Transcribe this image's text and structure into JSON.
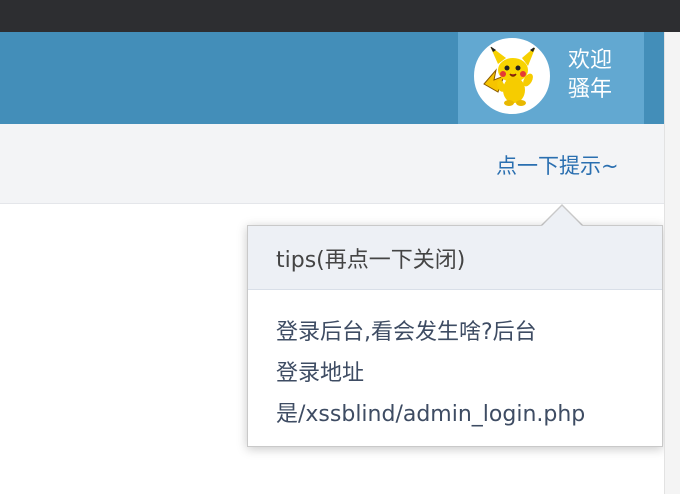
{
  "header": {
    "welcome_line1": "欢迎",
    "welcome_line2": "骚年",
    "avatar_icon": "pikachu-avatar-icon"
  },
  "subbar": {
    "tip_link": "点一下提示~"
  },
  "popover": {
    "title": "tips(再点一下关闭)",
    "body_line1": "登录后台,看会发生啥?后台",
    "body_line2": "登录地址",
    "body_line3": "是/xssblind/admin_login.php"
  },
  "colors": {
    "navbar": "#438eb9",
    "user_box": "#62a8d1",
    "link": "#2a6fb0",
    "popover_title_bg": "#edf0f5"
  }
}
